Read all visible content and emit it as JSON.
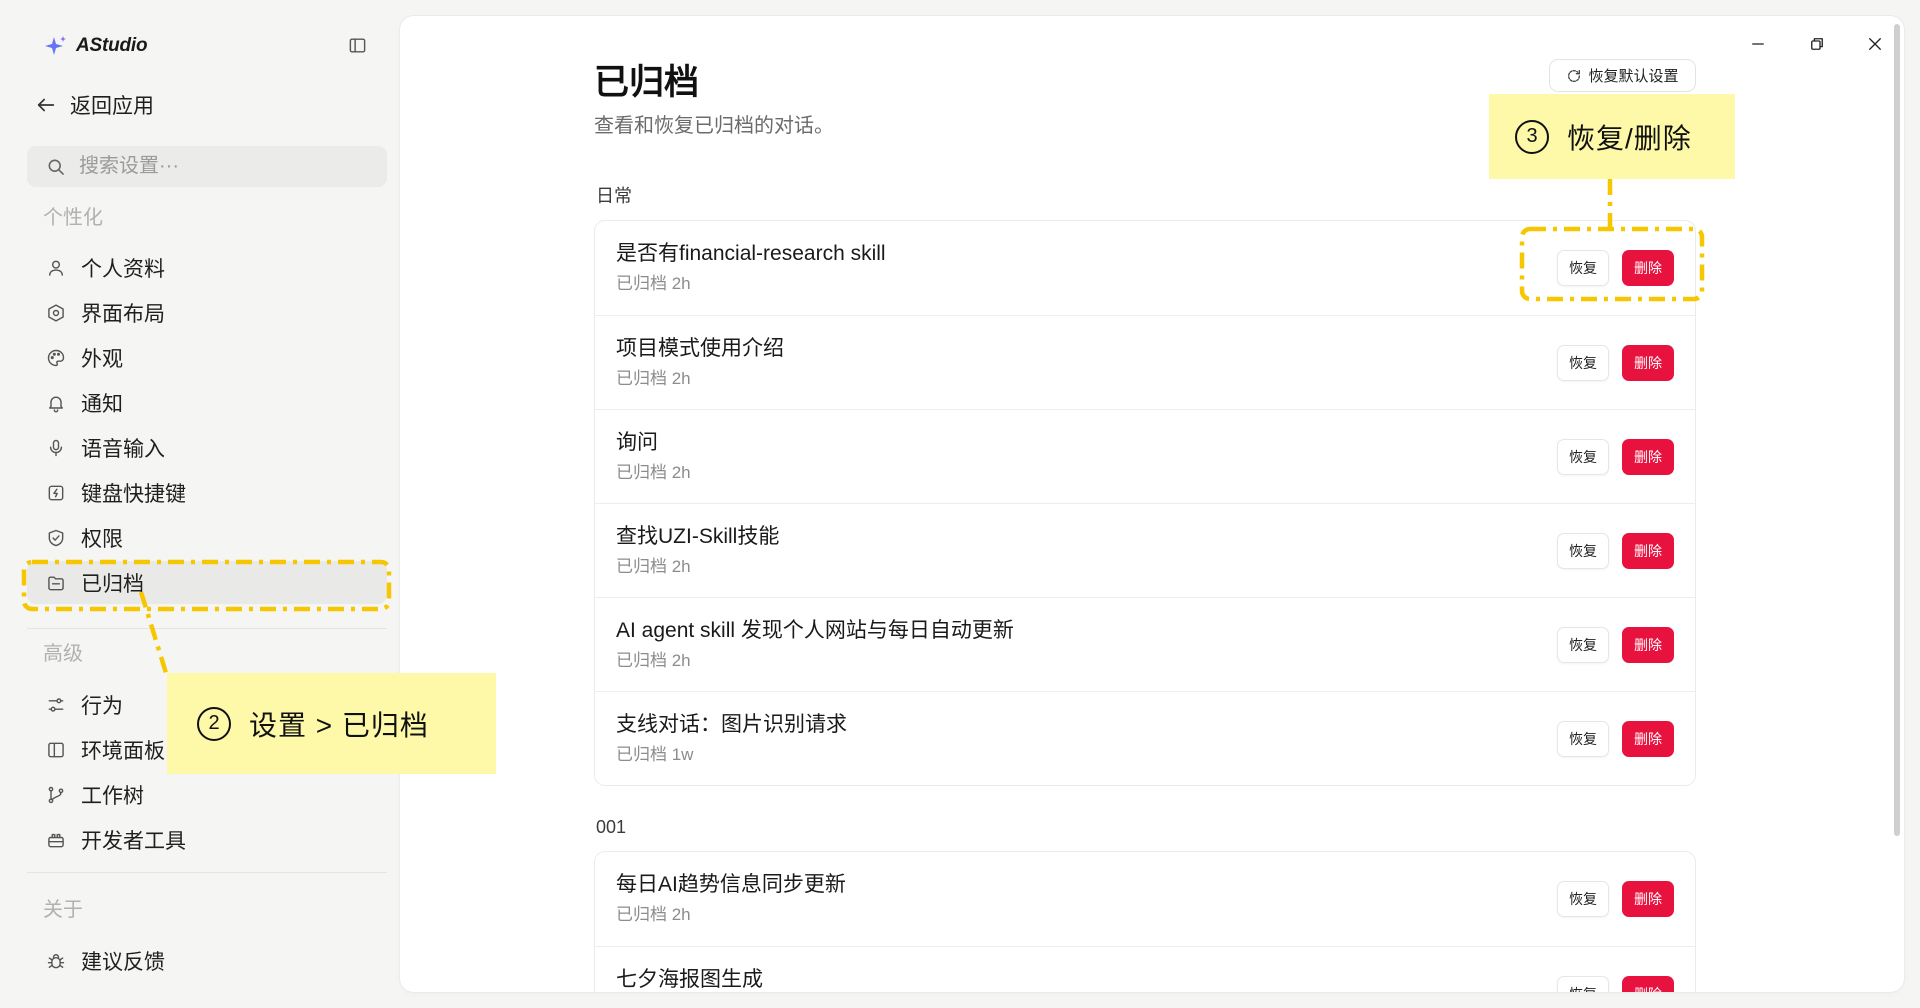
{
  "app": {
    "name": "AStudio",
    "logo_icon": "sparkle-icon"
  },
  "window_controls": {
    "minimize_icon": "minimize-icon",
    "restore_icon": "restore-window-icon",
    "close_icon": "close-icon"
  },
  "sidebar": {
    "toggle_icon": "sidebar-toggle-icon",
    "back": {
      "label": "返回应用",
      "icon": "arrow-left-icon"
    },
    "search": {
      "placeholder": "搜索设置···",
      "icon": "search-icon"
    },
    "sections": [
      {
        "title": "个性化",
        "items": [
          {
            "label": "个人资料",
            "icon": "user-icon"
          },
          {
            "label": "界面布局",
            "icon": "layout-icon"
          },
          {
            "label": "外观",
            "icon": "palette-icon"
          },
          {
            "label": "通知",
            "icon": "bell-icon"
          },
          {
            "label": "语音输入",
            "icon": "mic-icon"
          },
          {
            "label": "键盘快捷键",
            "icon": "shortcut-icon"
          },
          {
            "label": "权限",
            "icon": "shield-icon"
          },
          {
            "label": "已归档",
            "icon": "archive-icon",
            "selected": true
          }
        ]
      },
      {
        "title": "高级",
        "items": [
          {
            "label": "行为",
            "icon": "sliders-icon"
          },
          {
            "label": "环境面板",
            "icon": "panel-icon"
          },
          {
            "label": "工作树",
            "icon": "branch-icon"
          },
          {
            "label": "开发者工具",
            "icon": "toolbox-icon"
          }
        ]
      },
      {
        "title": "关于",
        "items": [
          {
            "label": "建议反馈",
            "icon": "bug-icon"
          }
        ]
      }
    ]
  },
  "header": {
    "reset_label": "恢复默认设置",
    "reset_icon": "refresh-icon"
  },
  "page": {
    "title": "已归档",
    "subtitle": "查看和恢复已归档的对话。"
  },
  "actions": {
    "restore_label": "恢复",
    "delete_label": "删除"
  },
  "groups": [
    {
      "name": "日常",
      "items": [
        {
          "title": "是否有financial-research skill",
          "meta": "已归档 2h"
        },
        {
          "title": "项目模式使用介绍",
          "meta": "已归档 2h"
        },
        {
          "title": "询问",
          "meta": "已归档 2h"
        },
        {
          "title": "查找UZI-Skill技能",
          "meta": "已归档 2h"
        },
        {
          "title": "AI agent skill 发现个人网站与每日自动更新",
          "meta": "已归档 2h"
        },
        {
          "title": "支线对话：图片识别请求",
          "meta": "已归档 1w"
        }
      ]
    },
    {
      "name": "001",
      "items": [
        {
          "title": "每日AI趋势信息同步更新",
          "meta": "已归档 2h"
        },
        {
          "title": "七夕海报图生成"
        }
      ]
    }
  ],
  "annotations": [
    {
      "number": "2",
      "text": "设置 > 已归档"
    },
    {
      "number": "3",
      "text": "恢复/删除"
    }
  ],
  "colors": {
    "delete_button": "#e8123f",
    "annotation_dash": "#f6c700",
    "callout_background": "#fdf9a8",
    "selected_item_background": "#e9e9e8",
    "window_background": "#f5f5f4"
  }
}
